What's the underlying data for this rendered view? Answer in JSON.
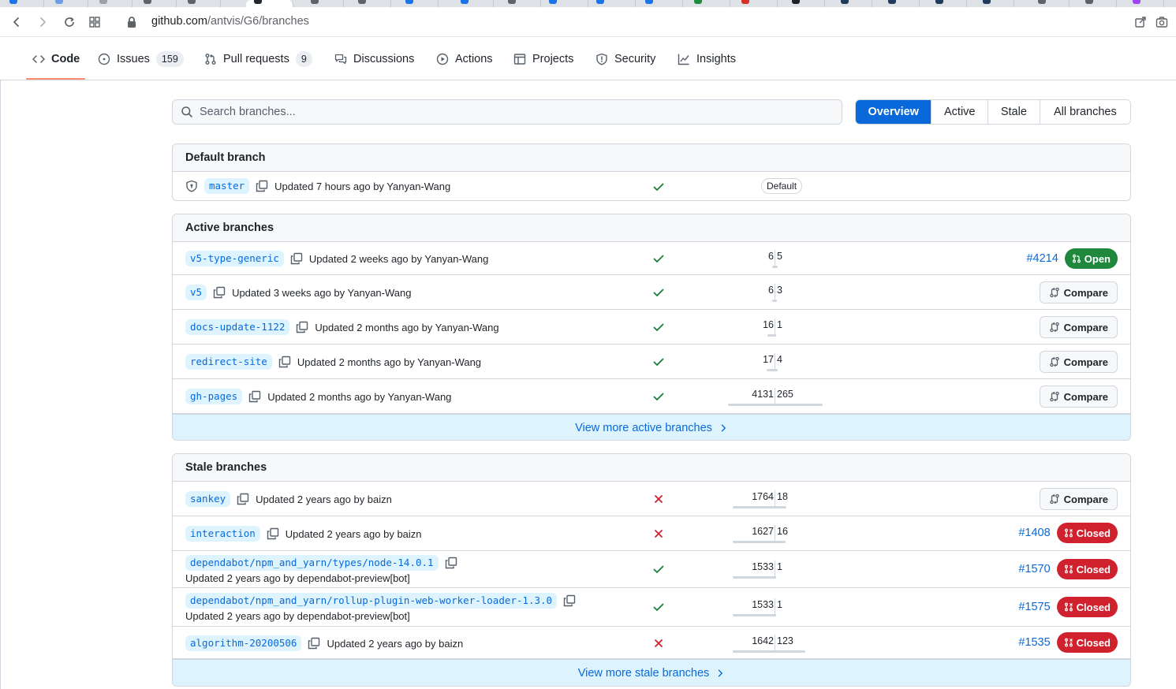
{
  "browser": {
    "url_host": "github.com",
    "url_path": "/antvis/G6/branches"
  },
  "repo_nav": {
    "code": "Code",
    "issues": "Issues",
    "issues_count": "159",
    "pulls": "Pull requests",
    "pulls_count": "9",
    "discussions": "Discussions",
    "actions": "Actions",
    "projects": "Projects",
    "security": "Security",
    "insights": "Insights"
  },
  "search": {
    "placeholder": "Search branches..."
  },
  "filters": [
    "Overview",
    "Active",
    "Stale",
    "All branches"
  ],
  "default_section": {
    "title": "Default branch",
    "branch": {
      "name": "master",
      "updated": "Updated 7 hours ago by Yanyan-Wang",
      "check": "pass",
      "label": "Default"
    }
  },
  "active_section": {
    "title": "Active branches",
    "branches": [
      {
        "name": "v5-type-generic",
        "updated": "Updated 2 weeks ago by Yanyan-Wang",
        "check": "pass",
        "behind": "6",
        "ahead": "5",
        "pr_number": "#4214",
        "pr_state": "Open"
      },
      {
        "name": "v5",
        "updated": "Updated 3 weeks ago by Yanyan-Wang",
        "check": "pass",
        "behind": "6",
        "ahead": "3",
        "action": "Compare"
      },
      {
        "name": "docs-update-1122",
        "updated": "Updated 2 months ago by Yanyan-Wang",
        "check": "pass",
        "behind": "16",
        "ahead": "1",
        "action": "Compare"
      },
      {
        "name": "redirect-site",
        "updated": "Updated 2 months ago by Yanyan-Wang",
        "check": "pass",
        "behind": "17",
        "ahead": "4",
        "action": "Compare"
      },
      {
        "name": "gh-pages",
        "updated": "Updated 2 months ago by Yanyan-Wang",
        "check": "pass",
        "behind": "4131",
        "ahead": "265",
        "action": "Compare"
      }
    ],
    "more": "View more active branches"
  },
  "stale_section": {
    "title": "Stale branches",
    "branches": [
      {
        "name": "sankey",
        "updated": "Updated 2 years ago by baizn",
        "check": "fail",
        "behind": "1764",
        "ahead": "18",
        "action": "Compare"
      },
      {
        "name": "interaction",
        "updated": "Updated 2 years ago by baizn",
        "check": "fail",
        "behind": "1627",
        "ahead": "16",
        "pr_number": "#1408",
        "pr_state": "Closed"
      },
      {
        "name": "dependabot/npm_and_yarn/types/node-14.0.1",
        "updated": "Updated 2 years ago by dependabot-preview[bot]",
        "check": "pass",
        "behind": "1533",
        "ahead": "1",
        "pr_number": "#1570",
        "pr_state": "Closed"
      },
      {
        "name": "dependabot/npm_and_yarn/rollup-plugin-web-worker-loader-1.3.0",
        "updated": "Updated 2 years ago by dependabot-preview[bot]",
        "check": "pass",
        "behind": "1533",
        "ahead": "1",
        "pr_number": "#1575",
        "pr_state": "Closed"
      },
      {
        "name": "algorithm-20200506",
        "updated": "Updated 2 years ago by baizn",
        "check": "fail",
        "behind": "1642",
        "ahead": "123",
        "pr_number": "#1535",
        "pr_state": "Closed"
      }
    ],
    "more": "View more stale branches"
  },
  "colors": {
    "accent": "#0969da",
    "open": "#1f883d",
    "closed": "#cf222e",
    "pass": "#1a7f37",
    "fail": "#cf222e"
  }
}
